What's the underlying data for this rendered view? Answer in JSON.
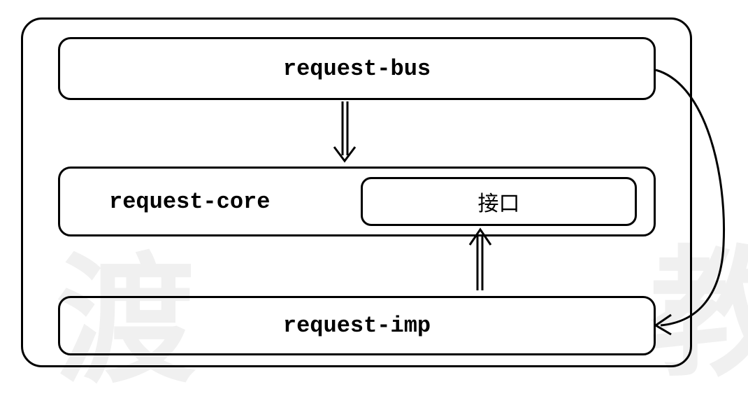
{
  "nodes": {
    "bus": "request-bus",
    "core": "request-core",
    "interface": "接口",
    "imp": "request-imp"
  },
  "watermark": {
    "left": "渡",
    "right": "教"
  },
  "edges": [
    {
      "from": "bus",
      "to": "core"
    },
    {
      "from": "imp",
      "to": "interface"
    },
    {
      "from": "bus",
      "to": "imp",
      "style": "curved"
    }
  ]
}
